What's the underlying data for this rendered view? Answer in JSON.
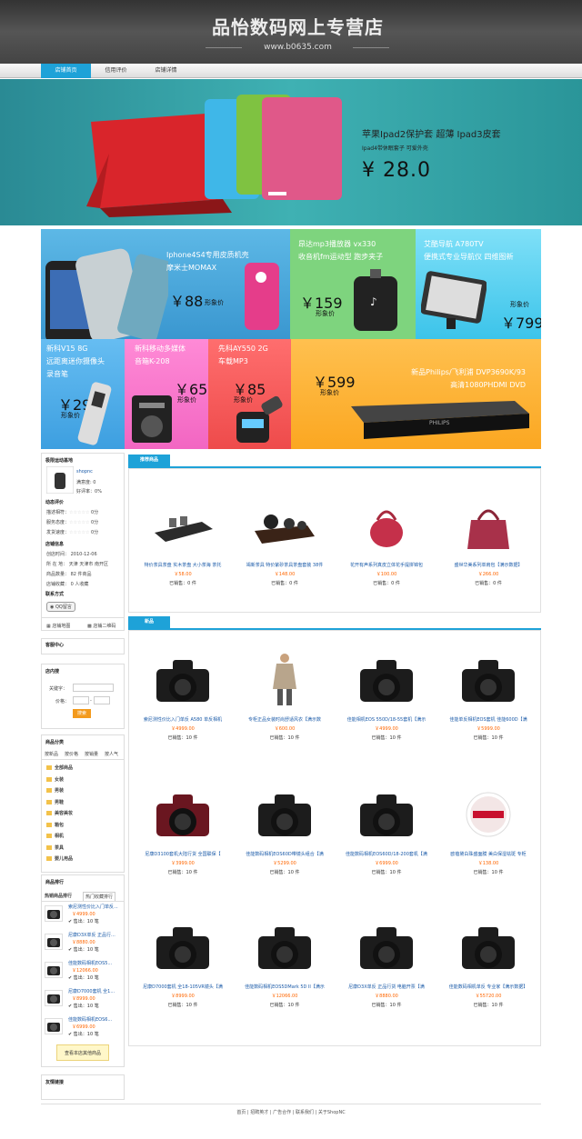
{
  "header": {
    "title": "品怡数码网上专营店",
    "url": "www.b0635.com"
  },
  "nav": {
    "items": [
      "店铺首页",
      "信用评价",
      "店铺详情"
    ]
  },
  "banner": {
    "line1": "苹果Ipad2保护套 超薄 Ipad3皮套",
    "line2": "Ipad4带休眠套子 可爱外壳",
    "price": "¥ 28.0"
  },
  "promos": [
    {
      "text": [
        "Iphone4S4专用皮质机壳",
        "摩米士MOMAX"
      ],
      "price": "￥88",
      "suffix": "形象价"
    },
    {
      "text": [
        "昂达mp3播放器 vx330",
        "收音机fm运动型 跑步夹子"
      ],
      "price": "￥159",
      "suffix": "形象价"
    },
    {
      "text": [
        "艾酷导航 A780TV",
        "便携式专业导航仪 四维图新"
      ],
      "price": "￥799",
      "suffix": "形象价"
    },
    {
      "text": [
        "新科V15 8G",
        "远距离迷你摄像头",
        "录音笔"
      ],
      "price": "￥299",
      "suffix": "形象价"
    },
    {
      "text": [
        "新科移动多媒体",
        "音箱K-208"
      ],
      "price": "￥65",
      "suffix": "形象价"
    },
    {
      "text": [
        "先科AY550 2G",
        "车载MP3"
      ],
      "price": "￥85",
      "suffix": "形象价"
    },
    {
      "text": [
        "新品Philips/飞利浦 DVP3690K/93",
        "高清1080PHDMI DVD"
      ],
      "price": "￥599",
      "suffix": "形象价"
    }
  ],
  "store": {
    "title": "极限运动基地",
    "user": "shopnc",
    "rate_label": "满意度:",
    "rate_val": "0",
    "good_label": "好评率：",
    "good_val": "0%",
    "eval_title": "动态评价",
    "evals": [
      {
        "l": "描述相符：",
        "v": "0分"
      },
      {
        "l": "服务态度：",
        "v": "0分"
      },
      {
        "l": "发货速度：",
        "v": "0分"
      }
    ],
    "info_title": "店铺信息",
    "info": [
      "创店时间： 2010-12-06",
      "所 在 地： 天津 天津市 南开区",
      "商品数量： 82 件商品",
      "店铺收藏： 0 人收藏"
    ],
    "contact_title": "联系方式",
    "qq": "QQ留言",
    "map": "店铺地图",
    "qr": "店铺二维码"
  },
  "service": {
    "title": "客服中心"
  },
  "search": {
    "title": "店内搜",
    "kw": "关键字：",
    "price": "价格：",
    "dash": "-",
    "btn": "搜索"
  },
  "cats": {
    "title": "商品分类",
    "tabs": [
      "按新品",
      "按价格",
      "按销量",
      "按人气"
    ],
    "items": [
      "全部商品",
      "女装",
      "男装",
      "男鞋",
      "美容美妆",
      "箱包",
      "相机",
      "茶具",
      "婴儿用品"
    ]
  },
  "rank": {
    "title": "商品排行",
    "tabs": [
      "热销商品排行",
      "热门收藏排行"
    ],
    "items": [
      {
        "n": "索尼测性价比入门单反...",
        "p": "￥4999.00",
        "s": "售出：10 笔"
      },
      {
        "n": "尼康D3X单反 正品行...",
        "p": "￥8880.00",
        "s": "售出：10 笔"
      },
      {
        "n": "佳能数码相机EOS5...",
        "p": "￥12066.00",
        "s": "售出：10 笔"
      },
      {
        "n": "尼康D7000套机 全1...",
        "p": "￥8999.00",
        "s": "售出：10 笔"
      },
      {
        "n": "佳能数码相机EOS6...",
        "p": "￥6999.00",
        "s": "售出：10 笔"
      }
    ],
    "more": "查看本店其他商品"
  },
  "links": {
    "title": "友情链接"
  },
  "rec": {
    "title": "推荐商品",
    "items": [
      {
        "n": "特价茶具茶盘 实木茶盘 大小茶海 茶托",
        "p": "￥58.00",
        "s": "已销售：0 件"
      },
      {
        "n": "竭新茶具 特价紫砂茶具茶盘套装 38件",
        "p": "￥148.00",
        "s": "已销售：0 件"
      },
      {
        "n": "花开有声系列真皮立体花手提拼锦包",
        "p": "￥100.00",
        "s": "已销售：0 件"
      },
      {
        "n": "盛世华美系列单肩包【满示数据】",
        "p": "￥266.00",
        "s": "已销售：0 件"
      }
    ]
  },
  "newp": {
    "title": "新品",
    "items": [
      {
        "n": "索尼测性价比入门单反 A580 单反相机",
        "p": "￥4999.00",
        "s": "已销售：10 件"
      },
      {
        "n": "专柜正品女装时尚舒适风衣【满示数",
        "p": "￥600.00",
        "s": "已销售：10 件"
      },
      {
        "n": "佳能相机EOS 550D/18-55套机【满示",
        "p": "￥4999.00",
        "s": "已销售：10 件"
      },
      {
        "n": "佳能单反相机EOS套机 佳能600D【满",
        "p": "￥5999.00",
        "s": "已销售：10 件"
      },
      {
        "n": "尼康D3100套机大陆行货 全国联保【",
        "p": "￥3999.00",
        "s": "已销售：10 件"
      },
      {
        "n": "佳能数码相机EOS60D带镜头组合【满",
        "p": "￥5299.00",
        "s": "已销售：10 件"
      },
      {
        "n": "佳能数码相机EOS60D/18-200套机【满",
        "p": "￥6999.00",
        "s": "已销售：10 件"
      },
      {
        "n": "欧蓓黛白珠盛面膜 美白保湿祛斑 专柜",
        "p": "￥138.00",
        "s": "已销售：10 件"
      },
      {
        "n": "尼康D7000套机 全18-105VR镜头【满",
        "p": "￥8999.00",
        "s": "已销售：10 件"
      },
      {
        "n": "佳能数码相机EOS5DMark 5D II【满示",
        "p": "￥12066.00",
        "s": "已销售：10 件"
      },
      {
        "n": "尼康D3X单反 正品行货 电脑开票【满",
        "p": "￥8880.00",
        "s": "已销售：10 件"
      },
      {
        "n": "佳能数码相机单反 专业家【满示数据】",
        "p": "￥55720.00",
        "s": "已销售：10 件"
      }
    ]
  },
  "footer": {
    "links": [
      "首页",
      "招聘英才",
      "广告合作",
      "联系我们",
      "关于ShopNC"
    ],
    "sep": "|"
  }
}
